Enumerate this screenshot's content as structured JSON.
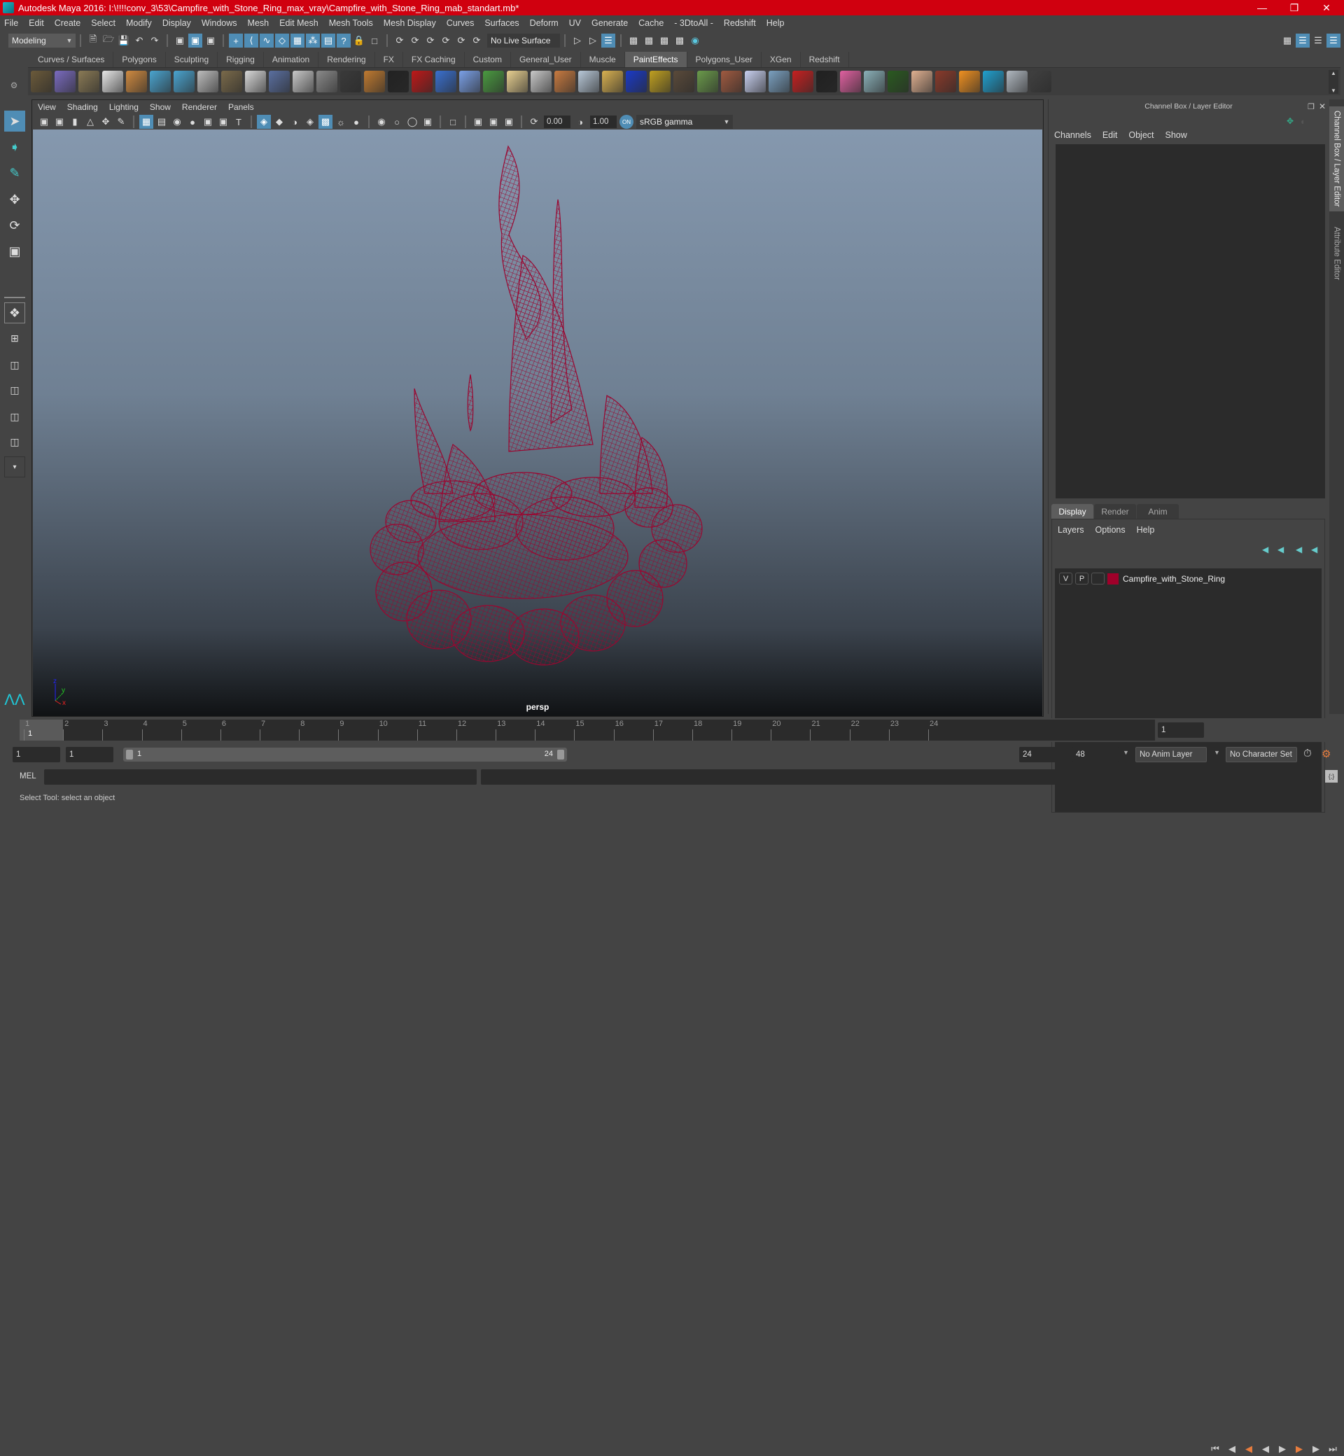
{
  "window": {
    "title": "Autodesk Maya 2016: I:\\!!!!conv_3\\53\\Campfire_with_Stone_Ring_max_vray\\Campfire_with_Stone_Ring_mab_standart.mb*",
    "minimize_icon": "minimize-icon",
    "maximize_icon": "restore-icon",
    "close_icon": "close-icon"
  },
  "menubar": [
    "File",
    "Edit",
    "Create",
    "Select",
    "Modify",
    "Display",
    "Windows",
    "Mesh",
    "Edit Mesh",
    "Mesh Tools",
    "Mesh Display",
    "Curves",
    "Surfaces",
    "Deform",
    "UV",
    "Generate",
    "Cache",
    "- 3DtoAll -",
    "Redshift",
    "Help"
  ],
  "statusline": {
    "mode": "Modeling",
    "live_surface": "No Live Surface"
  },
  "shelf": {
    "tabs": [
      "Curves / Surfaces",
      "Polygons",
      "Sculpting",
      "Rigging",
      "Animation",
      "Rendering",
      "FX",
      "FX Caching",
      "Custom",
      "General_User",
      "Muscle",
      "PaintEffects",
      "Polygons_User",
      "XGen",
      "Redshift"
    ],
    "active_tab": "PaintEffects",
    "icon_colors": [
      "#6b5a3a",
      "#7a6bc0",
      "#8a7a55",
      "#e8e8e8",
      "#d08a40",
      "#4aa4d0",
      "#4aa4d0",
      "#bdbdbd",
      "#7a6a4a",
      "#d8d8d8",
      "#5a6fa0",
      "#c8c8c8",
      "#8a8a8a",
      "#3a3a3a",
      "#c07a30",
      "#222222",
      "#c01818",
      "#3a70d0",
      "#7aa0e8",
      "#4a9a40",
      "#e8d090",
      "#c8c8c8",
      "#c87a40",
      "#b8c8d8",
      "#d8b050",
      "#1a3ac8",
      "#c0a020",
      "#5a4a3a",
      "#6a9a4a",
      "#a05a40",
      "#c8d0f0",
      "#7aa0c0",
      "#c82020",
      "#202020",
      "#e060a0",
      "#8ab0b8",
      "#2a5a20",
      "#e0b090",
      "#8a3a2a",
      "#f09020",
      "#20a0d0",
      "#b0b8c0",
      "#404040"
    ]
  },
  "viewport": {
    "menu": [
      "View",
      "Shading",
      "Lighting",
      "Show",
      "Renderer",
      "Panels"
    ],
    "exposure": "0.00",
    "gamma": "1.00",
    "color_space": "sRGB gamma",
    "camera_label": "persp",
    "axis": {
      "x": "x",
      "y": "y",
      "z": "z"
    },
    "wireframe_color": "#9a0630"
  },
  "channel_box": {
    "title": "Channel Box / Layer Editor",
    "menu": [
      "Channels",
      "Edit",
      "Object",
      "Show"
    ]
  },
  "layer_editor": {
    "tabs": [
      "Display",
      "Render",
      "Anim"
    ],
    "active_tab": "Display",
    "menu": [
      "Layers",
      "Options",
      "Help"
    ],
    "layers": [
      {
        "visible": "V",
        "playback": "P",
        "name": "Campfire_with_Stone_Ring",
        "color": "#a0002a"
      }
    ]
  },
  "side_tabs": [
    "Channel Box / Layer Editor",
    "Attribute Editor"
  ],
  "timeline": {
    "ticks": [
      "1",
      "2",
      "3",
      "4",
      "5",
      "6",
      "7",
      "8",
      "9",
      "10",
      "11",
      "12",
      "13",
      "14",
      "15",
      "16",
      "17",
      "18",
      "19",
      "20",
      "21",
      "22",
      "23",
      "24"
    ],
    "current_frame_marker": "1",
    "current_frame": "1"
  },
  "range": {
    "start": "1",
    "playback_start": "1",
    "slider_start": "1",
    "slider_end": "24",
    "playback_end": "24",
    "end": "48",
    "anim_layer": "No Anim Layer",
    "character_set": "No Character Set"
  },
  "command": {
    "language": "MEL"
  },
  "help_line": "Select Tool: select an object"
}
